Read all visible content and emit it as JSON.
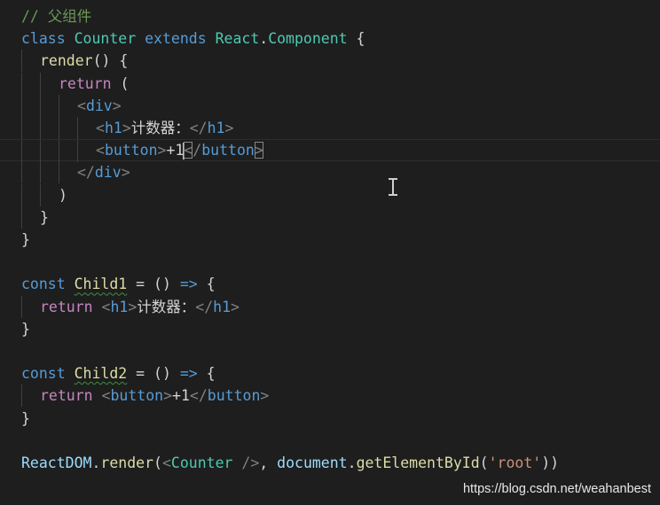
{
  "editor": {
    "lines": [
      [
        [
          "// 父组件",
          "comment"
        ]
      ],
      [
        [
          "class ",
          "kw"
        ],
        [
          "Counter ",
          "cls"
        ],
        [
          "extends ",
          "kw"
        ],
        [
          "React",
          "cls"
        ],
        [
          ".",
          "text"
        ],
        [
          "Component ",
          "cls"
        ],
        [
          "{",
          "text"
        ]
      ],
      [
        [
          "render",
          "fn"
        ],
        [
          "() {",
          "text"
        ]
      ],
      [
        [
          "return ",
          "ctrl"
        ],
        [
          "(",
          "text"
        ]
      ],
      [
        [
          "<",
          "punct"
        ],
        [
          "div",
          "tag"
        ],
        [
          ">",
          "punct"
        ]
      ],
      [
        [
          "<",
          "punct"
        ],
        [
          "h1",
          "tag"
        ],
        [
          ">",
          "punct"
        ],
        [
          "计数器：",
          "text"
        ],
        [
          "</",
          "punct"
        ],
        [
          "h1",
          "tag"
        ],
        [
          ">",
          "punct"
        ]
      ],
      [
        [
          "<",
          "punct"
        ],
        [
          "button",
          "tag"
        ],
        [
          ">",
          "punct"
        ],
        [
          "+1",
          "text"
        ],
        [
          "</",
          "punct"
        ],
        [
          "button",
          "tag"
        ],
        [
          ">",
          "punct"
        ]
      ],
      [
        [
          "</",
          "punct"
        ],
        [
          "div",
          "tag"
        ],
        [
          ">",
          "punct"
        ]
      ],
      [
        [
          ")",
          "text"
        ]
      ],
      [
        [
          "}",
          "text"
        ]
      ],
      [
        [
          "}",
          "text"
        ]
      ],
      [],
      [
        [
          "const ",
          "kw"
        ],
        [
          "Child1",
          "yellowsq"
        ],
        [
          " = () ",
          "text"
        ],
        [
          "=>",
          "kw"
        ],
        [
          " {",
          "text"
        ]
      ],
      [
        [
          "return ",
          "ctrl"
        ],
        [
          "<",
          "punct"
        ],
        [
          "h1",
          "tag"
        ],
        [
          ">",
          "punct"
        ],
        [
          "计数器：",
          "text"
        ],
        [
          "</",
          "punct"
        ],
        [
          "h1",
          "tag"
        ],
        [
          ">",
          "punct"
        ]
      ],
      [
        [
          "}",
          "text"
        ]
      ],
      [],
      [
        [
          "const ",
          "kw"
        ],
        [
          "Child2",
          "yellowsq"
        ],
        [
          " = () ",
          "text"
        ],
        [
          "=>",
          "kw"
        ],
        [
          " {",
          "text"
        ]
      ],
      [
        [
          "return ",
          "ctrl"
        ],
        [
          "<",
          "punct"
        ],
        [
          "button",
          "tag"
        ],
        [
          ">",
          "punct"
        ],
        [
          "+1",
          "text"
        ],
        [
          "</",
          "punct"
        ],
        [
          "button",
          "tag"
        ],
        [
          ">",
          "punct"
        ]
      ],
      [
        [
          "}",
          "text"
        ]
      ],
      [],
      [
        [
          "ReactDOM",
          "var"
        ],
        [
          ".",
          "text"
        ],
        [
          "render",
          "fn"
        ],
        [
          "(",
          "text"
        ],
        [
          "<",
          "punct"
        ],
        [
          "Counter ",
          "cls"
        ],
        [
          "/>",
          "punct"
        ],
        [
          ", ",
          "text"
        ],
        [
          "document",
          "var"
        ],
        [
          ".",
          "text"
        ],
        [
          "getElementById",
          "fn"
        ],
        [
          "(",
          "text"
        ],
        [
          "'root'",
          "str"
        ],
        [
          "))",
          "text"
        ]
      ]
    ]
  },
  "watermark": "https://blog.csdn.net/weahanbest"
}
